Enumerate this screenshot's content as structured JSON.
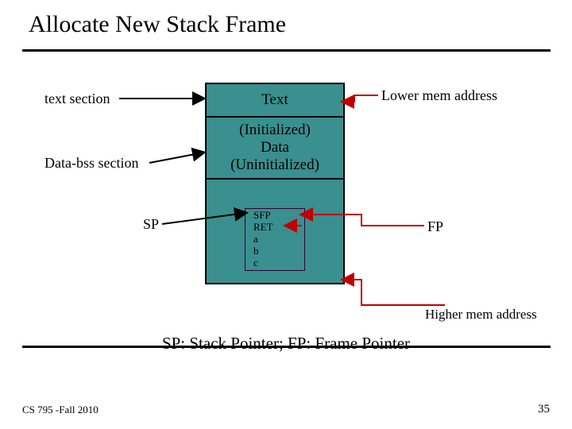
{
  "title": "Allocate New Stack Frame",
  "labels": {
    "text_section": "text section",
    "data_bss": "Data-bss section",
    "sp": "SP",
    "lower": "Lower mem address",
    "fp": "FP",
    "higher": "Higher mem address"
  },
  "segments": {
    "text": "Text",
    "data_line1": "(Initialized)",
    "data_line2": "Data",
    "data_line3": "(Uninitialized)",
    "stack_items": {
      "l1": "SFP",
      "l2": "RET",
      "l3": "a",
      "l4": "b",
      "l5": "c"
    }
  },
  "caption": "SP: Stack Pointer; FP: Frame Pointer",
  "footer": {
    "left": "CS 795 -Fall 2010",
    "right": "35"
  },
  "colors": {
    "segment_fill": "#3a8f8f",
    "arrow_red": "#c00000"
  }
}
